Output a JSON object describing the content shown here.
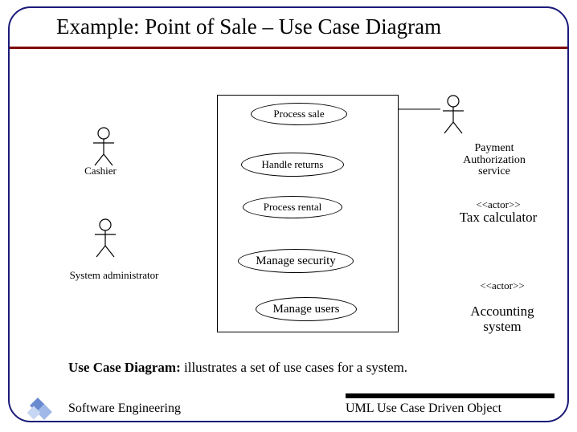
{
  "title": "Example: Point of Sale – Use Case Diagram",
  "actors": {
    "cashier": "Cashier",
    "sysadmin": "System administrator",
    "payment_service": "Payment\nAuthorization\nservice",
    "tax_calc_stereo": "<<actor>>",
    "tax_calc": "Tax calculator",
    "accounting_stereo": "<<actor>>",
    "accounting": "Accounting\nsystem"
  },
  "usecases": {
    "process_sale": "Process sale",
    "handle_returns": "Handle returns",
    "process_rental": "Process rental",
    "manage_security": "Manage security",
    "manage_users": "Manage users"
  },
  "caption_bold": "Use Case Diagram:",
  "caption_rest": " illustrates a set of use cases for a system.",
  "footer": {
    "left": "Software Engineering",
    "right": "UML Use Case Driven Object"
  }
}
